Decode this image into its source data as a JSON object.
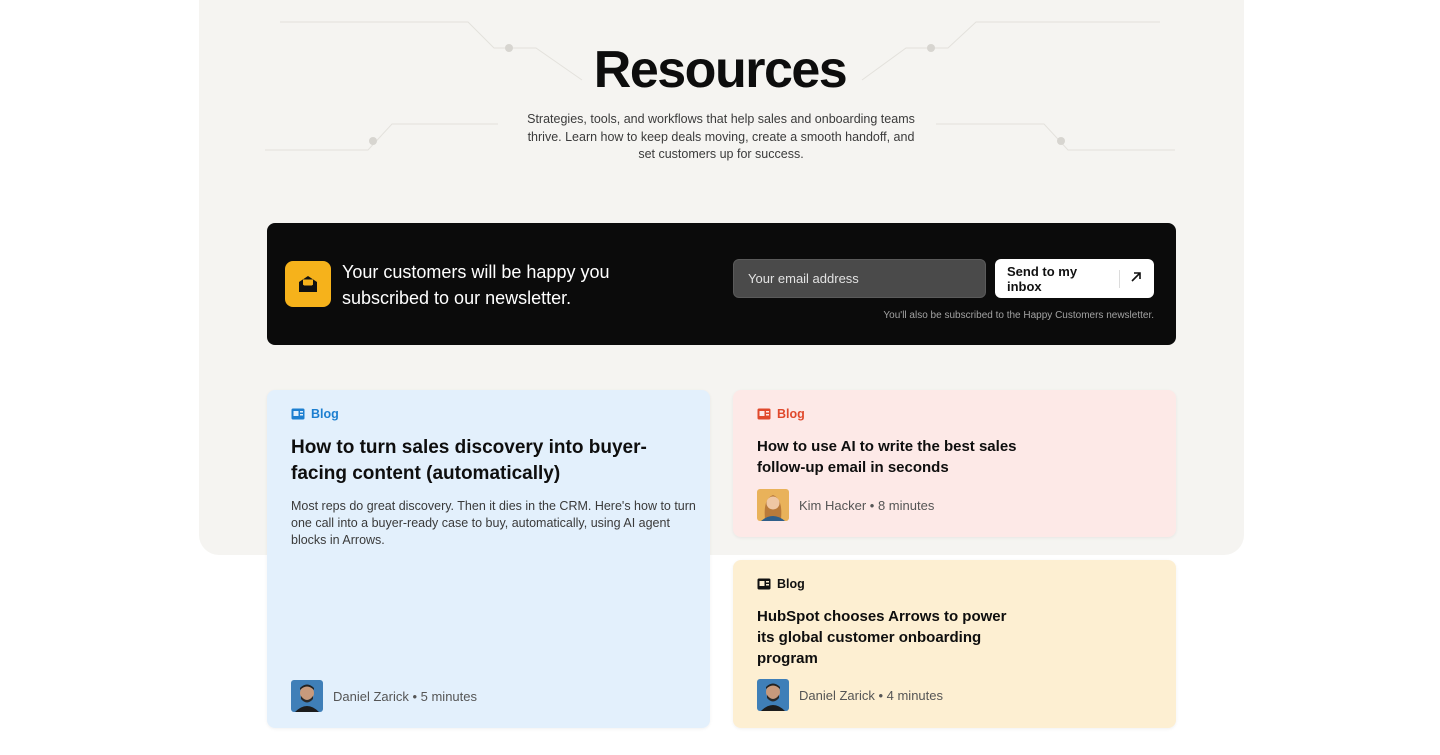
{
  "hero": {
    "title": "Resources",
    "subtitle": "Strategies, tools, and workflows that help sales and onboarding teams thrive. Learn how to keep deals moving, create a smooth handoff, and set customers up for success."
  },
  "newsletter": {
    "headline": "Your customers will be happy you subscribed to our newsletter.",
    "email_placeholder": "Your email address",
    "submit_label": "Send to my inbox",
    "note": "You'll also be subscribed to the Happy Customers newsletter.",
    "icon": "envelope-open-icon",
    "icon_color": "#f6b21b"
  },
  "cards": [
    {
      "tag": "Blog",
      "tag_color": "#1d7fd0",
      "title": "How to turn sales discovery into buyer-facing content (automatically)",
      "description": "Most reps do great discovery. Then it dies in the CRM. Here's how to turn one call into a buyer-ready case to buy, automatically, using AI agent blocks in Arrows.",
      "author": "Daniel Zarick • 5 minutes",
      "bg": "#e3f0fc"
    },
    {
      "tag": "Blog",
      "tag_color": "#e0492c",
      "title": "How to use AI to write the best sales follow-up email in seconds",
      "author": "Kim Hacker • 8 minutes",
      "bg": "#fde9e7"
    },
    {
      "tag": "Blog",
      "tag_color": "#111111",
      "title": "HubSpot chooses Arrows to power its global customer onboarding program",
      "author": "Daniel Zarick • 4 minutes",
      "bg": "#fdefd2"
    }
  ]
}
